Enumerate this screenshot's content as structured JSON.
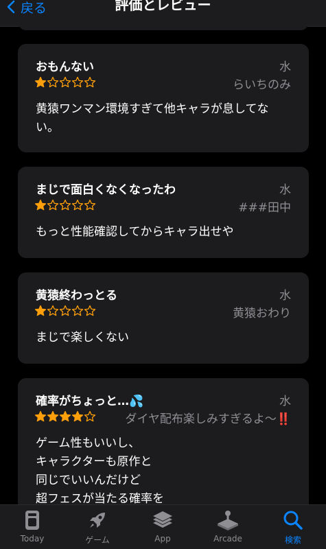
{
  "header": {
    "back_label": "戻る",
    "title": "評価とレビュー"
  },
  "reviews": [
    {
      "title": "おもんない",
      "date": "水",
      "rating": 1,
      "author": "らいちのみ",
      "body": [
        "黄猿ワンマン環境すぎて他キャラが息してな",
        "い。"
      ]
    },
    {
      "title": "まじで面白くなくなったわ",
      "date": "水",
      "rating": 1,
      "author": "###田中",
      "body": [
        "もっと性能確認してからキャラ出せや"
      ]
    },
    {
      "title": "黄猿終わっとる",
      "date": "水",
      "rating": 1,
      "author": "黄猿おわり",
      "body": [
        "まじで楽しくない"
      ]
    },
    {
      "title": "確率がちょっと…💦",
      "date": "水",
      "rating": 4,
      "author": "ダイヤ配布楽しみすぎるよ〜",
      "author_suffix": "‼️",
      "body": [
        "ゲーム性もいいし、",
        "キャラクターも原作と",
        "同じでいいんだけど",
        "超フェスが当たる確率を"
      ]
    }
  ],
  "tabbar": {
    "tabs": [
      {
        "label": "Today",
        "icon": "today-icon"
      },
      {
        "label": "ゲーム",
        "icon": "rocket-icon"
      },
      {
        "label": "App",
        "icon": "layers-icon"
      },
      {
        "label": "Arcade",
        "icon": "joystick-icon"
      },
      {
        "label": "検索",
        "icon": "search-icon"
      }
    ],
    "active_index": 4
  },
  "colors": {
    "accent": "#0a84ff",
    "star": "#ff9f0a",
    "card": "#1c1c1e",
    "secondary_text": "#8e8e93"
  }
}
